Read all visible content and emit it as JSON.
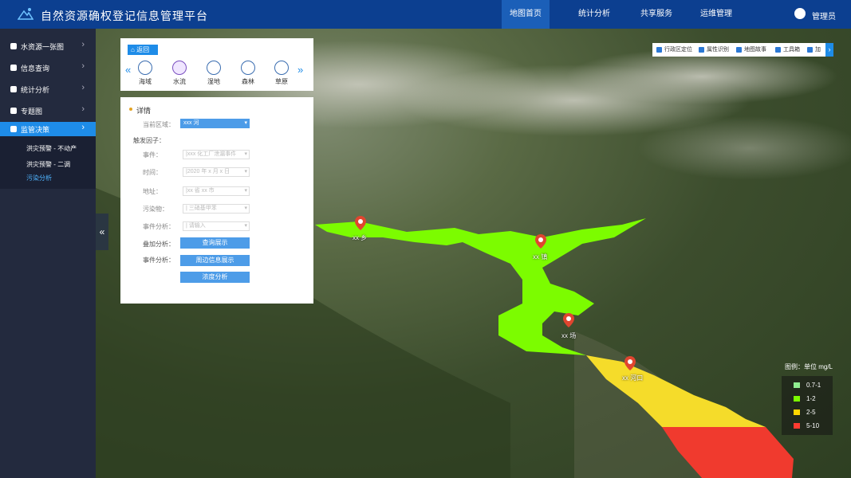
{
  "header": {
    "app_title": "自然资源确权登记信息管理平台",
    "nav": [
      "地图首页",
      "统计分析",
      "共享服务",
      "运维管理"
    ],
    "user": "管理员"
  },
  "sidebar": {
    "items": [
      {
        "label": "水资源一张图",
        "icon": "water-icon"
      },
      {
        "label": "信息查询",
        "icon": "document-icon"
      },
      {
        "label": "统计分析",
        "icon": "chart-icon"
      },
      {
        "label": "专题图",
        "icon": "layers-icon"
      },
      {
        "label": "监管决策",
        "icon": "shield-icon"
      }
    ],
    "sub_items": [
      "洪灾预警 - 不动产",
      "洪灾预警 - 二调",
      "污染分析"
    ]
  },
  "category_panel": {
    "back_label": "返回",
    "categories": [
      "海域",
      "水流",
      "湿地",
      "森林",
      "草原"
    ]
  },
  "detail_panel": {
    "title": "详情",
    "region_label": "当前区域：",
    "region_value": "xxx 河",
    "trigger_label": "触发因子：",
    "event_label": "事件：",
    "event_value": "|xxx 化工厂泄漏事件",
    "time_label": "时间：",
    "time_value": "|2020 年 x 月 x 日",
    "address_label": "地址：",
    "address_value": "|xx 省 xx 市",
    "pollutant_label": "污染物：",
    "pollutant_value": "| 三硝基甲苯",
    "event_analysis_label": "事件分析：",
    "event_analysis_placeholder": "| 请输入",
    "overlay_label": "叠加分析：",
    "overlay_button": "查询展示",
    "event_analysis_label2": "事件分析：",
    "surrounding_button": "周边信息展示",
    "concentration_button": "浓度分析"
  },
  "toolbar": {
    "items": [
      "行政区定位",
      "属性识别",
      "地图故事",
      "工具箱",
      "加"
    ]
  },
  "map": {
    "markers": [
      "xx 乡",
      "xx 镇",
      "xx 场",
      "xx 河口"
    ]
  },
  "legend": {
    "title": "图例：单位 mg/L",
    "rows": [
      {
        "label": "0.7-1",
        "color": "#90ee90"
      },
      {
        "label": "1-2",
        "color": "#7cfc00"
      },
      {
        "label": "2-5",
        "color": "#ffd700"
      },
      {
        "label": "5-10",
        "color": "#ff3b30"
      }
    ]
  }
}
